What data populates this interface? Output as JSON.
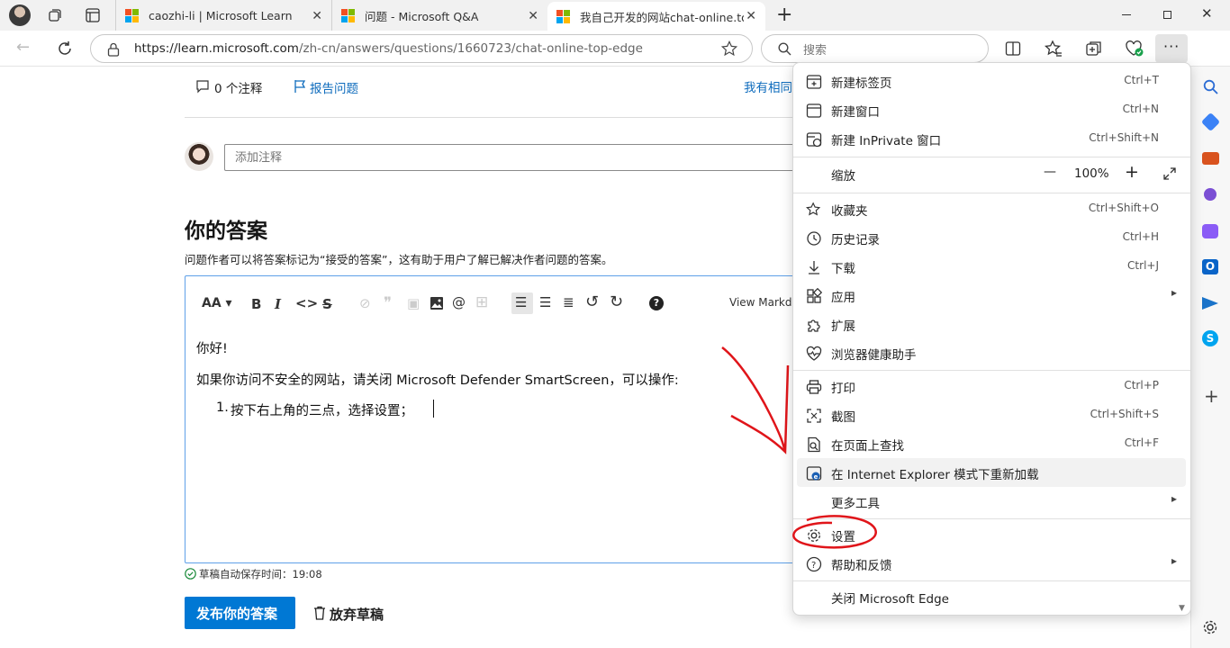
{
  "tabs": [
    {
      "title": "caozhi-li | Microsoft Learn"
    },
    {
      "title": "问题 - Microsoft Q&A"
    },
    {
      "title": "我自己开发的网站chat-online.top"
    }
  ],
  "address": {
    "url_host": "https://learn.microsoft.com",
    "url_path": "/zh-cn/answers/questions/1660723/chat-online-top-edge",
    "search_placeholder": "搜索"
  },
  "page": {
    "comments_count": "0 个注释",
    "report_label": "报告问题",
    "same_question_cut": "我有相同",
    "comment_placeholder": "添加注释",
    "answer_heading": "你的答案",
    "answer_hint": "问题作者可以将答案标记为“接受的答案”，这有助于用户了解已解决作者问题的答案。",
    "view_markdown": "View Markdo",
    "editor_line1": "你好!",
    "editor_line2": "如果你访问不安全的网站，请关闭 Microsoft Defender SmartScreen，可以操作:",
    "editor_list_num": "1.",
    "editor_list_item": "按下右上角的三点，选择设置；",
    "autosave": "草稿自动保存时间：19:08",
    "publish_button": "发布你的答案",
    "discard_button": "放弃草稿"
  },
  "menu": {
    "new_tab": {
      "label": "新建标签页",
      "shortcut": "Ctrl+T"
    },
    "new_window": {
      "label": "新建窗口",
      "shortcut": "Ctrl+N"
    },
    "new_inprivate": {
      "label": "新建 InPrivate 窗口",
      "shortcut": "Ctrl+Shift+N"
    },
    "zoom": {
      "label": "缩放",
      "minus": "—",
      "value": "100%",
      "plus": "+"
    },
    "favorites": {
      "label": "收藏夹",
      "shortcut": "Ctrl+Shift+O"
    },
    "history": {
      "label": "历史记录",
      "shortcut": "Ctrl+H"
    },
    "downloads": {
      "label": "下载",
      "shortcut": "Ctrl+J"
    },
    "apps": {
      "label": "应用"
    },
    "extensions": {
      "label": "扩展"
    },
    "health": {
      "label": "浏览器健康助手"
    },
    "print": {
      "label": "打印",
      "shortcut": "Ctrl+P"
    },
    "screenshot": {
      "label": "截图",
      "shortcut": "Ctrl+Shift+S"
    },
    "find": {
      "label": "在页面上查找",
      "shortcut": "Ctrl+F"
    },
    "ie_mode": {
      "label": "在 Internet Explorer 模式下重新加载"
    },
    "more_tools": {
      "label": "更多工具"
    },
    "settings": {
      "label": "设置"
    },
    "help": {
      "label": "帮助和反馈"
    },
    "close_edge": {
      "label": "关闭 Microsoft Edge"
    }
  },
  "colors": {
    "accent": "#0f6cbd",
    "publish_bg": "#0078d4",
    "annotation_red": "#e0151a",
    "ms_red": "#f25022",
    "ms_green": "#7fba00",
    "ms_blue": "#00a4ef",
    "ms_yellow": "#ffb900"
  }
}
